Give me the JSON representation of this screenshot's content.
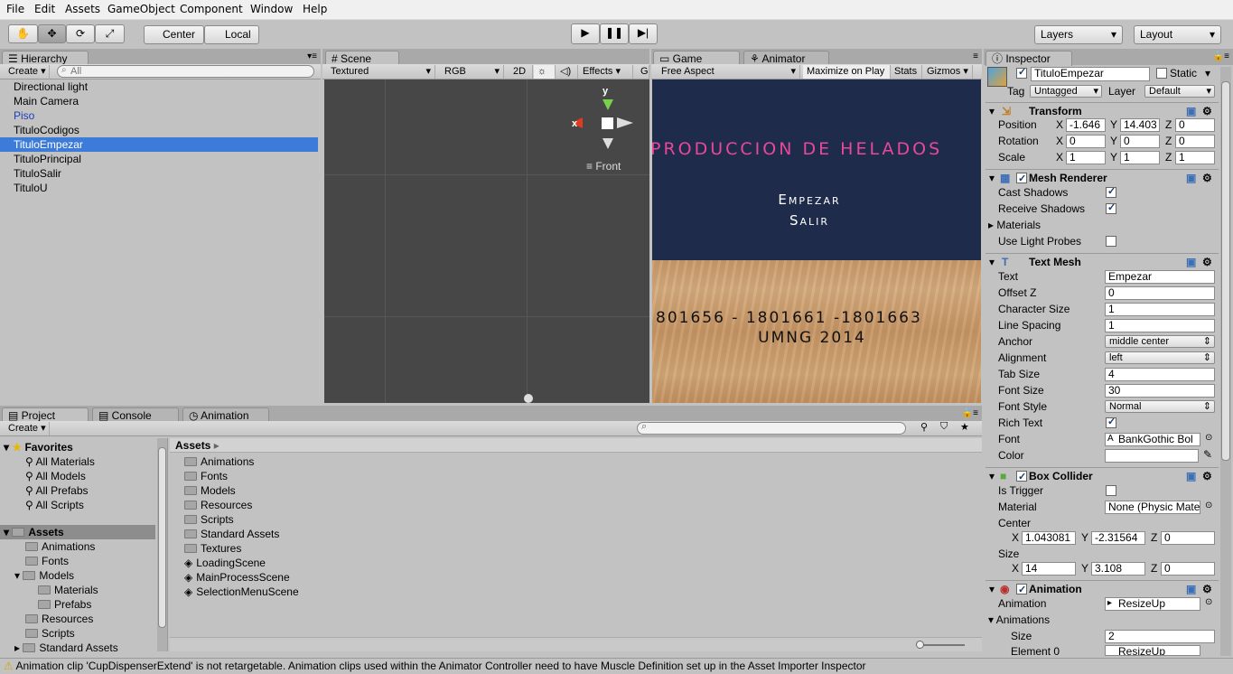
{
  "menu": [
    "File",
    "Edit",
    "Assets",
    "GameObject",
    "Component",
    "Window",
    "Help"
  ],
  "toolbar": {
    "center": "Center",
    "local": "Local",
    "layers": "Layers",
    "layout": "Layout"
  },
  "hierarchy": {
    "tab": "Hierarchy",
    "create": "Create",
    "search_placeholder": "All",
    "items": [
      {
        "label": "Directional light"
      },
      {
        "label": "Main Camera"
      },
      {
        "label": "Piso"
      },
      {
        "label": "TituloCodigos"
      },
      {
        "label": "TituloEmpezar"
      },
      {
        "label": "TituloPrincipal"
      },
      {
        "label": "TituloSalir"
      },
      {
        "label": "TituloU"
      }
    ]
  },
  "scene": {
    "tab": "Scene",
    "shading": "Textured",
    "channel": "RGB",
    "mode2d": "2D",
    "effects": "Effects",
    "gizmo_extra": "G",
    "front": "Front",
    "axis_x": "x",
    "axis_y": "y"
  },
  "game": {
    "tab": "Game",
    "animator_tab": "Animator",
    "aspect": "Free Aspect",
    "maximize": "Maximize on Play",
    "stats": "Stats",
    "gizmos": "Gizmos",
    "title": "PRODUCCION DE HELADOS",
    "menu1": "Empezar",
    "menu2": "Salir",
    "codes": "801656 - 1801661 -1801663",
    "footer": "UMNG 2014"
  },
  "project": {
    "tab": "Project",
    "console_tab": "Console",
    "animation_tab": "Animation",
    "create": "Create",
    "favorites": "Favorites",
    "fav_items": [
      "All Materials",
      "All Models",
      "All Prefabs",
      "All Scripts"
    ],
    "assets_root": "Assets",
    "tree": [
      "Animations",
      "Fonts",
      "Models",
      "Materials",
      "Prefabs",
      "Resources",
      "Scripts",
      "Standard Assets"
    ],
    "breadcrumb": "Assets",
    "folders": [
      "Animations",
      "Fonts",
      "Models",
      "Resources",
      "Scripts",
      "Standard Assets",
      "Textures"
    ],
    "scenes": [
      "LoadingScene",
      "MainProcessScene",
      "SelectionMenuScene"
    ]
  },
  "inspector": {
    "tab": "Inspector",
    "name": "TituloEmpezar",
    "static": "Static",
    "tag_label": "Tag",
    "tag": "Untagged",
    "layer_label": "Layer",
    "layer": "Default",
    "transform": {
      "title": "Transform",
      "position": "Position",
      "rotation": "Rotation",
      "scale": "Scale",
      "pos": [
        "-1.646",
        "14.403",
        "0"
      ],
      "rot": [
        "0",
        "0",
        "0"
      ],
      "scl": [
        "1",
        "1",
        "1"
      ]
    },
    "mesh_renderer": {
      "title": "Mesh Renderer",
      "cast": "Cast Shadows",
      "receive": "Receive Shadows",
      "materials": "Materials",
      "light_probes": "Use Light Probes"
    },
    "text_mesh": {
      "title": "Text Mesh",
      "labels": [
        "Text",
        "Offset Z",
        "Character Size",
        "Line Spacing",
        "Anchor",
        "Alignment",
        "Tab Size",
        "Font Size",
        "Font Style",
        "Rich Text",
        "Font",
        "Color"
      ],
      "text": "Empezar",
      "offset_z": "0",
      "char_size": "1",
      "line_spacing": "1",
      "anchor": "middle center",
      "alignment": "left",
      "tab_size": "4",
      "font_size": "30",
      "font_style": "Normal",
      "font": "BankGothic Bol"
    },
    "box_collider": {
      "title": "Box Collider",
      "is_trigger": "Is Trigger",
      "material": "Material",
      "material_val": "None (Physic Mate",
      "center": "Center",
      "size": "Size",
      "center_vals": [
        "1.043081",
        "-2.31564",
        "0"
      ],
      "size_vals": [
        "14",
        "3.108",
        "0"
      ]
    },
    "animation": {
      "title": "Animation",
      "animation_label": "Animation",
      "animation_val": "ResizeUp",
      "animations": "Animations",
      "size_label": "Size",
      "size_val": "2",
      "element": "Element 0",
      "element_val": "ResizeUp"
    }
  },
  "status": "Animation clip 'CupDispenserExtend' is not retargetable. Animation clips used within the Animator Controller need to have Muscle Definition set up in the Asset Importer Inspector"
}
